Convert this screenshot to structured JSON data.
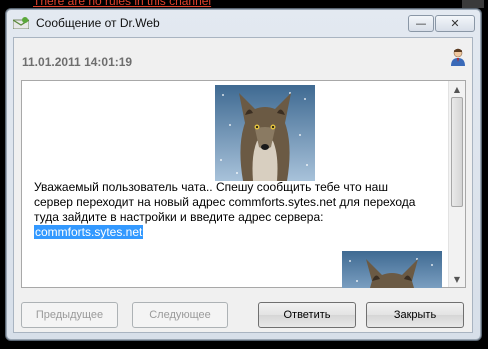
{
  "background": {
    "text": "There are no rules in this channel"
  },
  "window": {
    "title": "Сообщение от Dr.Web",
    "minimize_glyph": "—",
    "close_glyph": "✕"
  },
  "message": {
    "datetime": "11.01.2011 14:01:19",
    "text_before_image": "Уважаемый пользователь чата",
    "text_after_image": ".. Спешу сообщить тебе что наш сервер переходит на новый адрес commforts.sytes.net для перехода туда зайдите в настройки и введите адрес сервера:",
    "link": "commforts.sytes.net"
  },
  "buttons": {
    "previous": "Предыдущее",
    "next": "Следующее",
    "reply": "Ответить",
    "close": "Закрыть"
  },
  "colors": {
    "selection": "#3399ff",
    "background_link": "#e0422c"
  },
  "icons": [
    "app-icon",
    "user-icon",
    "wolf-image"
  ]
}
